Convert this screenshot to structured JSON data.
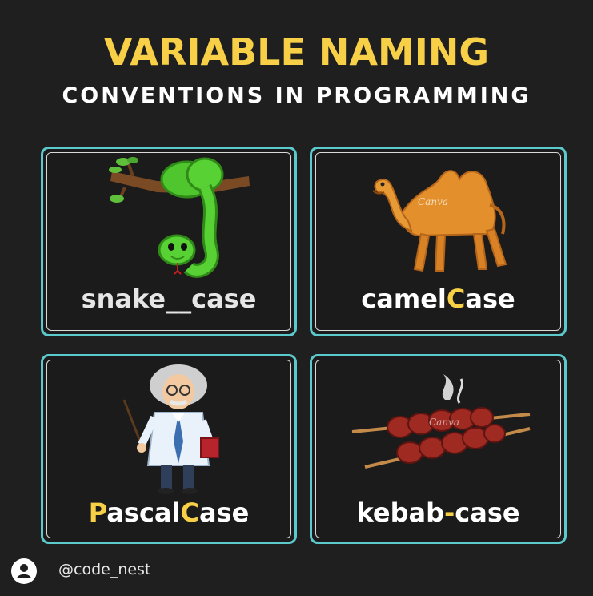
{
  "header": {
    "title": "VARIABLE NAMING",
    "subtitle": "CONVENTIONS IN PROGRAMMING"
  },
  "cards": [
    {
      "id": "snake",
      "illustration": "snake-on-branch",
      "label_parts": [
        "snake",
        "_",
        "_case"
      ]
    },
    {
      "id": "camel",
      "illustration": "camel",
      "label_parts": [
        "camel",
        "C",
        "ase"
      ]
    },
    {
      "id": "pascal",
      "illustration": "professor-with-pointer",
      "label_parts": [
        "P",
        "ascal",
        "C",
        "ase"
      ]
    },
    {
      "id": "kebab",
      "illustration": "kebab-skewers",
      "label_parts": [
        "kebab",
        "-",
        "case"
      ]
    }
  ],
  "watermark": "Canva",
  "footer": {
    "handle": "@code_nest",
    "icon": "user-avatar-icon"
  },
  "colors": {
    "background": "#1f1f1f",
    "accent_yellow": "#f7d047",
    "card_border": "#5cc9cc",
    "text": "#ffffff"
  }
}
